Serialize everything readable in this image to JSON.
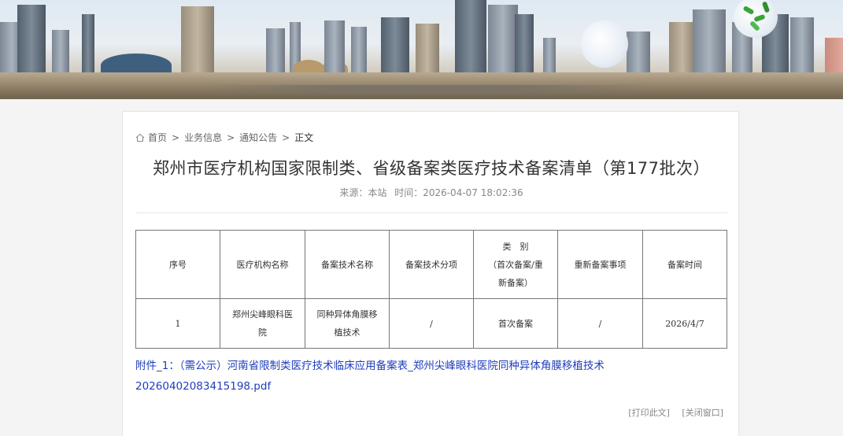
{
  "breadcrumb": {
    "home": "首页",
    "separator": ">",
    "items": [
      "业务信息",
      "通知公告"
    ],
    "current": "正文"
  },
  "article": {
    "title": "郑州市医疗机构国家限制类、省级备案类医疗技术备案清单（第177批次）",
    "source_label": "来源：本站",
    "time_label": "时间：2026-04-07 18:02:36"
  },
  "table": {
    "headers": {
      "index": "序号",
      "institution": "医疗机构名称",
      "technology": "备案技术名称",
      "sub_item": "备案技术分项",
      "category_line1": "类　别",
      "category_line2": "（首次备案/重新备案）",
      "refile_items": "重新备案事项",
      "filing_time": "备案时间"
    },
    "rows": [
      {
        "index": "1",
        "institution": "郑州尖峰眼科医院",
        "technology": "同种异体角膜移植技术",
        "sub_item": "/",
        "category": "首次备案",
        "refile_items": "/",
        "filing_time": "2026/4/7"
      }
    ]
  },
  "attachment": {
    "text": "附件_1：（需公示）河南省限制类医疗技术临床应用备案表_郑州尖峰眼科医院同种异体角膜移植技术20260402083415198.pdf"
  },
  "actions": {
    "print": "[打印此文]",
    "close": "[关闭窗口]"
  },
  "colors": {
    "link": "#1f3dbb",
    "text": "#333333",
    "muted": "#888888",
    "page_bg": "#f4f4f4"
  }
}
